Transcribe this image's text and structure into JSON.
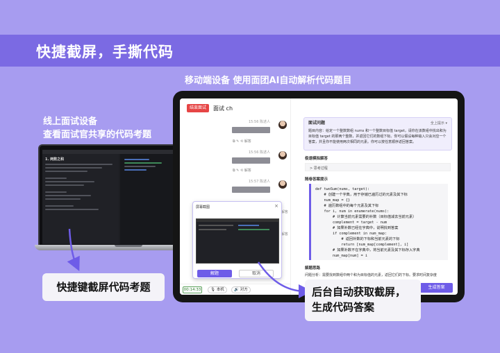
{
  "banner": {
    "title": "快捷截屏，手撕代码"
  },
  "captions": {
    "mobile": "移动端设备 使用面团AI自动解析代码题目",
    "left_line1": "线上面试设备",
    "left_line2": "查看面试官共享的代码考题"
  },
  "callouts": {
    "left": "快捷键截屏代码考题",
    "right_line1": "后台自动获取截屏，",
    "right_line2": "生成代码答案"
  },
  "chat": {
    "end_button": "结束面试",
    "title": "面试 ch",
    "messages": [
      {
        "time": "15:56",
        "sender": "陈述人"
      },
      {
        "time": "15:56",
        "sender": "陈述人"
      },
      {
        "time": "15:57",
        "sender": "陈述人"
      }
    ],
    "tool_label": "解答",
    "timer": "00:14:33",
    "mic_label": "本机",
    "speaker_label": "对方"
  },
  "answer": {
    "q_section": "面试问题",
    "q_right": "全上提示 ▾",
    "question": "题目内容：给定一个整数数组 nums 和一个整数目标值 target，请你在该数组中找出和为目标值 target 的那两个整数，并返回它们的数组下标。你可以假设每种输入只会对应一个答案，并且你不能使用两次相同的元素。你可以按任意顺序返回答案。",
    "think_section": "极速模拟解答",
    "think_item": "> 思考过程",
    "code_section": "随卷答案提示",
    "code": "def twoSum(nums, target):\n    # 创建一个字典，用于存储已遍历过的元素及其下标\n    num_map = {}\n    # 遍历数组中的每个元素及其下标\n    for i, num in enumerate(nums):\n        # 计算当前元素需要的补数（目标值减去当前元素）\n        complement = target - num\n        # 如果补数已经在字典中，说明找到答案\n        if complement in num_map:\n            # 返回补数的下标和当前元素的下标\n            return [num_map[complement], i]\n        # 如果补数不在字典中，将当前元素及其下标存入字典\n        num_map[num] = i",
    "expl_section": "解题思路",
    "expl_text": "问题分析：需要找到数组中两个和为目标值的元素，返回它们的下标。要求时间复杂度",
    "generate_button": "生成答案"
  },
  "popup": {
    "title": "屏幕截图",
    "close": "×",
    "solve_button": "解题",
    "cancel_button": "取消"
  },
  "laptop": {
    "question_title": "1. 两数之和"
  }
}
